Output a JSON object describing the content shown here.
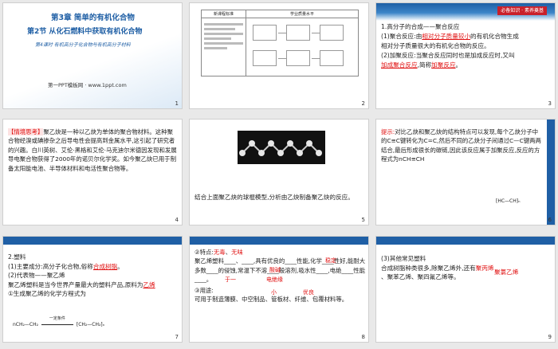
{
  "slide1": {
    "chapter": "第3章   简单的有机化合物",
    "section": "第2节 从化石燃料中获取有机化合物",
    "lesson": "第4课时  有机高分子化合物与有机高分子材料",
    "site": "第一PPT模板网 · www.1ppt.com",
    "num": "1"
  },
  "slide2": {
    "table_headers": [
      "新课程标准",
      "学业质量水平"
    ],
    "num": "2"
  },
  "slide3": {
    "badge": "必备知识 · 素养奠基",
    "l1": "1.高分子的合成——聚合反应",
    "l2a": "(1)聚合反应:由",
    "l2b": "相对分子质量较小",
    "l2c": "的有机化合物生成",
    "l3": "相对分子质量很大的有机化合物的反应。",
    "l4": "(2)加聚反应:当聚合反应同时也是加成反应时,又叫",
    "l5a": "加成聚合反应",
    "l5b": ",简称",
    "l5c": "加聚反应",
    "l5d": "。",
    "num": "3"
  },
  "slide4": {
    "tag": "【情境思考】",
    "text": "聚乙炔是一种以乙炔为单体的聚合物材料。这种聚合物经溴或碘掺杂之后导电性会提高到金属水平,这引起了研究者的兴趣。白川英树、艾伦·黑格和艾伦·马克迪尔米德因发现和发展导电聚合物获得了2000年的诺贝尔化学奖。如今聚乙炔已用于制备太阳能电池、半导体材料和电活性聚合物等。",
    "num": "4"
  },
  "slide5": {
    "text": "结合上面聚乙炔的球棍模型,分析由乙炔制备聚乙炔的反应。",
    "num": "5"
  },
  "slide6": {
    "tag": "提示:",
    "text": "对比乙炔和聚乙炔的结构特点可以发现,每个乙炔分子中的C≡C键转化为C=C,然后不同的乙炔分子间通过C—C键两两结合,最后形成很长的碳链,因此该反应属于加聚反应,反应的方程式为nCH≡CH",
    "product": "⁅HC—CH⁆ₙ",
    "num": "6"
  },
  "slide7": {
    "l1": "2.塑料",
    "l2a": "(1)主要成分:高分子化合物,俗称",
    "l2b": "合成树脂",
    "l2c": "。",
    "l3": "(2)代表物——聚乙烯",
    "l4": "聚乙烯塑料是当今世界产量最大的塑料产品,原料为",
    "l4b": "乙烯",
    "l5": "①生成聚乙烯的化学方程式为",
    "eq_left": "nCH₂—CH₂",
    "eq_cond": "一定条件",
    "eq_right": "⁅CH₂—CH₂⁆ₙ",
    "num": "7"
  },
  "slide8": {
    "l1a": "②特点:",
    "l1b": "无毒",
    "l1c": "、",
    "l1d": "无味",
    "l2": "聚乙烯塑料____、____,具有优良的____性能,化学____性好,能耐大多数____的侵蚀,常温下不溶____般溶剂,吸水性____,电绝____性能____。",
    "red1": "稳定",
    "red2": "酸碱",
    "red3": "于一",
    "red4": "电绝缘",
    "red5": "小",
    "red6": "优良",
    "l3": "③用途:",
    "l4": "可用于制造薄膜、中空制品、管板材、纤维、包覆材料等。",
    "num": "8"
  },
  "slide9": {
    "l1": "(3)其他常见塑料",
    "l2": "合成树脂种类很多,除聚乙烯外,还有",
    "l2r": "聚丙烯",
    "l3": "、聚苯乙烯、聚四氟乙烯等。",
    "l3r": "聚氯乙烯",
    "num": "9"
  }
}
